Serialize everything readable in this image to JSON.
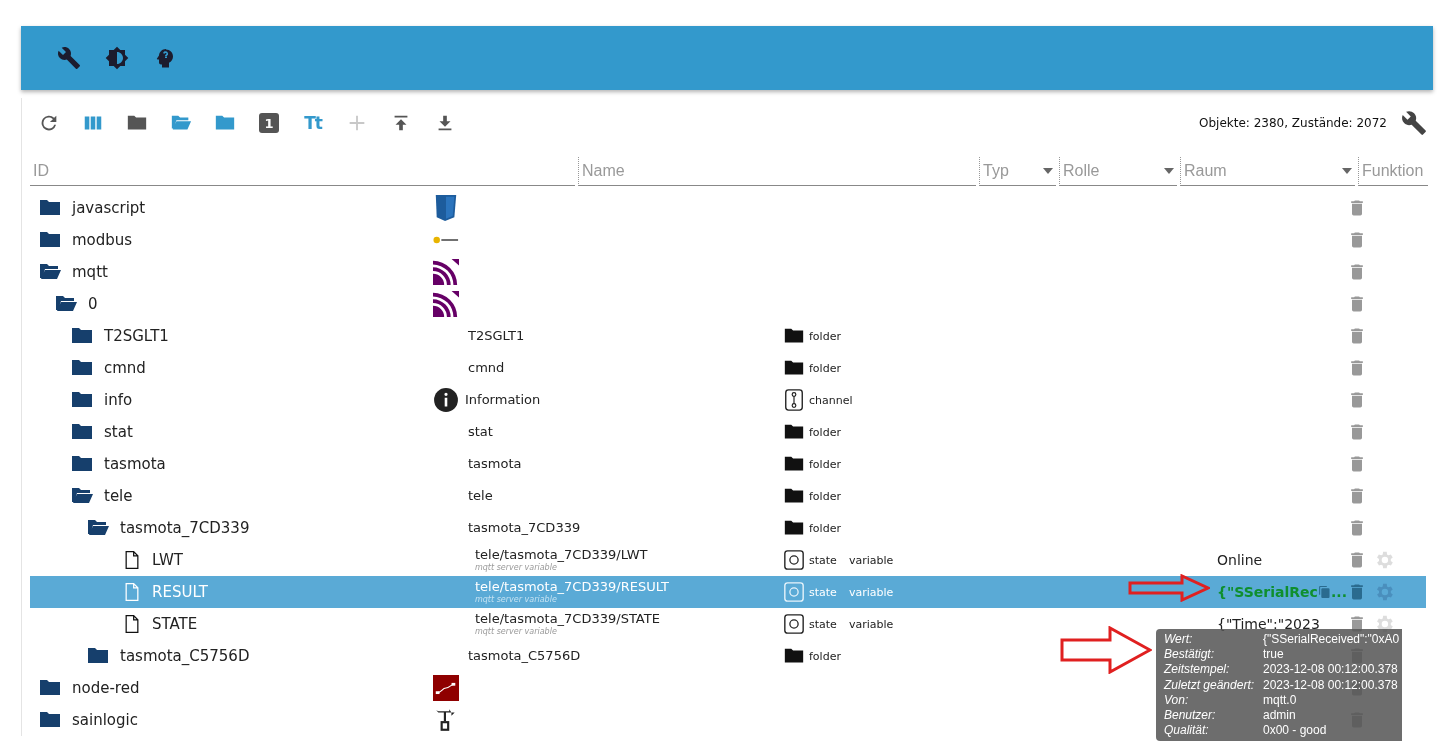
{
  "header": {
    "icons": [
      {
        "kind": "wrench"
      },
      {
        "kind": "brightness"
      },
      {
        "kind": "head"
      }
    ]
  },
  "toolbar": {
    "buttons": [
      {
        "kind": "refresh",
        "disabled": false
      },
      {
        "kind": "columns",
        "disabled": false
      },
      {
        "kind": "folder-grey",
        "disabled": false
      },
      {
        "kind": "folder-open",
        "disabled": false
      },
      {
        "kind": "folder",
        "disabled": false
      },
      {
        "kind": "number",
        "text": "1",
        "disabled": false
      },
      {
        "kind": "text-size",
        "text": "Tt",
        "disabled": false
      },
      {
        "kind": "add",
        "disabled": true
      },
      {
        "kind": "upload",
        "disabled": false
      },
      {
        "kind": "download",
        "disabled": false
      }
    ],
    "counts": "Objekte: 2380, Zustände: 2072"
  },
  "filters": [
    {
      "kind": "text",
      "placeholder": "ID"
    },
    {
      "kind": "text",
      "placeholder": "Name"
    },
    {
      "kind": "select",
      "placeholder": "Typ"
    },
    {
      "kind": "select",
      "placeholder": "Rolle"
    },
    {
      "kind": "select",
      "placeholder": "Raum"
    },
    {
      "kind": "text",
      "placeholder": "Funktion"
    }
  ],
  "tree": [
    {
      "id": "javascript",
      "kind": "folder",
      "expanded": false,
      "selected": false,
      "logo": {
        "kind": "js"
      }
    },
    {
      "id": "modbus",
      "kind": "folder",
      "expanded": false,
      "selected": false,
      "logo": {
        "kind": "modbus"
      }
    },
    {
      "id": "mqtt",
      "kind": "folder",
      "expanded": true,
      "selected": false,
      "logo": {
        "kind": "mqtt"
      },
      "children": [
        {
          "id": "0",
          "kind": "folder",
          "expanded": true,
          "selected": false,
          "logo": {
            "kind": "mqtt"
          },
          "children": [
            {
              "id": "T2SGLT1",
              "kind": "folder",
              "expanded": false,
              "selected": false,
              "name": "T2SGLT1",
              "type_icon": {
                "kind": "folder"
              },
              "type_label": "folder"
            },
            {
              "id": "cmnd",
              "kind": "folder",
              "expanded": false,
              "selected": false,
              "name": "cmnd",
              "type_icon": {
                "kind": "folder"
              },
              "type_label": "folder"
            },
            {
              "id": "info",
              "kind": "folder",
              "expanded": false,
              "selected": false,
              "logo": {
                "kind": "info"
              },
              "name": "Information",
              "type_icon": {
                "kind": "channel"
              },
              "type_label": "channel"
            },
            {
              "id": "stat",
              "kind": "folder",
              "expanded": false,
              "selected": false,
              "name": "stat",
              "type_icon": {
                "kind": "folder"
              },
              "type_label": "folder"
            },
            {
              "id": "tasmota",
              "kind": "folder",
              "expanded": false,
              "selected": false,
              "name": "tasmota",
              "type_icon": {
                "kind": "folder"
              },
              "type_label": "folder"
            },
            {
              "id": "tele",
              "kind": "folder",
              "expanded": true,
              "selected": false,
              "name": "tele",
              "type_icon": {
                "kind": "folder"
              },
              "type_label": "folder",
              "children": [
                {
                  "id": "tasmota_7CD339",
                  "kind": "folder",
                  "expanded": true,
                  "selected": false,
                  "name": "tasmota_7CD339",
                  "type_icon": {
                    "kind": "folder"
                  },
                  "type_label": "folder",
                  "children": [
                    {
                      "id": "LWT",
                      "kind": "state",
                      "selected": false,
                      "name": "tele/tasmota_7CD339/LWT",
                      "name_sub": "mqtt server variable",
                      "type_icon": {
                        "kind": "state"
                      },
                      "type_label": "state",
                      "role": "variable",
                      "value": "Online"
                    },
                    {
                      "id": "RESULT",
                      "kind": "state",
                      "selected": true,
                      "name": "tele/tasmota_7CD339/RESULT",
                      "name_sub": "mqtt server variable",
                      "type_icon": {
                        "kind": "state"
                      },
                      "type_label": "state",
                      "role": "variable",
                      "value": "{\"SSerialRec",
                      "value_suffix": "...",
                      "color": "#0f8f2e",
                      "copy": true
                    },
                    {
                      "id": "STATE",
                      "kind": "state",
                      "selected": false,
                      "name": "tele/tasmota_7CD339/STATE",
                      "name_sub": "mqtt server variable",
                      "type_icon": {
                        "kind": "state"
                      },
                      "type_label": "state",
                      "role": "variable",
                      "value": "{\"Time\":\"2023"
                    }
                  ]
                },
                {
                  "id": "tasmota_C5756D",
                  "kind": "folder",
                  "expanded": false,
                  "selected": false,
                  "name": "tasmota_C5756D",
                  "type_icon": {
                    "kind": "folder"
                  },
                  "type_label": "folder"
                }
              ]
            }
          ]
        }
      ]
    },
    {
      "id": "node-red",
      "kind": "folder",
      "expanded": false,
      "selected": false,
      "logo": {
        "kind": "nodered"
      }
    },
    {
      "id": "sainlogic",
      "kind": "folder",
      "expanded": false,
      "selected": false,
      "logo": {
        "kind": "sainlogic"
      }
    }
  ],
  "tooltip": {
    "rows": [
      {
        "label": "Wert:",
        "value": "{\"SSerialReceived\":\"0xA0"
      },
      {
        "label": "Bestätigt:",
        "value": "true"
      },
      {
        "label": "Zeitstempel:",
        "value": "2023-12-08 00:12:00.378"
      },
      {
        "label": "Zuletzt geändert:",
        "value": "2023-12-08 00:12:00.378"
      },
      {
        "label": "Von:",
        "value": "mqtt.0"
      },
      {
        "label": "Benutzer:",
        "value": "admin"
      },
      {
        "label": "Qualität:",
        "value": "0x00 - good"
      }
    ]
  }
}
